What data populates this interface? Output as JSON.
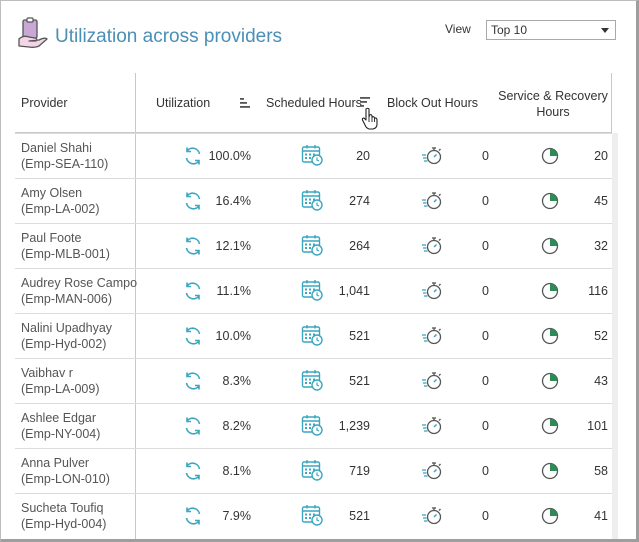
{
  "header": {
    "title": "Utilization across providers",
    "view_label": "View",
    "view_selected": "Top 10"
  },
  "columns": {
    "provider": "Provider",
    "utilization": "Utilization",
    "scheduled": "Scheduled Hours",
    "blockout": "Block Out Hours",
    "service_line1": "Service & Recovery",
    "service_line2": "Hours"
  },
  "icons": {
    "logo": "provider-clipboard-icon",
    "utilization": "refresh-icon",
    "scheduled": "calendar-clock-icon",
    "blockout": "stopwatch-icon",
    "service": "pie-chart-icon",
    "sort": "sort-icon",
    "cursor": "hand-cursor-icon"
  },
  "colors": {
    "title": "#4a8fb5",
    "icon_teal": "#3aa6bf",
    "pie_green": "#2e8b57"
  },
  "rows": [
    {
      "name": "Daniel Shahi",
      "id": "(Emp-SEA-110)",
      "utilization": "100.0%",
      "scheduled": "20",
      "blockout": "0",
      "service": "20",
      "service_fraction": 0.25
    },
    {
      "name": "Amy Olsen",
      "id": "(Emp-LA-002)",
      "utilization": "16.4%",
      "scheduled": "274",
      "blockout": "0",
      "service": "45",
      "service_fraction": 0.25
    },
    {
      "name": "Paul Foote",
      "id": "(Emp-MLB-001)",
      "utilization": "12.1%",
      "scheduled": "264",
      "blockout": "0",
      "service": "32",
      "service_fraction": 0.25
    },
    {
      "name": "Audrey Rose Campo",
      "id": "(Emp-MAN-006)",
      "utilization": "11.1%",
      "scheduled": "1,041",
      "blockout": "0",
      "service": "116",
      "service_fraction": 0.25
    },
    {
      "name": "Nalini Upadhyay",
      "id": "(Emp-Hyd-002)",
      "utilization": "10.0%",
      "scheduled": "521",
      "blockout": "0",
      "service": "52",
      "service_fraction": 0.25
    },
    {
      "name": "Vaibhav r",
      "id": "(Emp-LA-009)",
      "utilization": "8.3%",
      "scheduled": "521",
      "blockout": "0",
      "service": "43",
      "service_fraction": 0.25
    },
    {
      "name": "Ashlee Edgar",
      "id": "(Emp-NY-004)",
      "utilization": "8.2%",
      "scheduled": "1,239",
      "blockout": "0",
      "service": "101",
      "service_fraction": 0.25
    },
    {
      "name": "Anna Pulver",
      "id": "(Emp-LON-010)",
      "utilization": "8.1%",
      "scheduled": "719",
      "blockout": "0",
      "service": "58",
      "service_fraction": 0.25
    },
    {
      "name": "Sucheta Toufiq",
      "id": "(Emp-Hyd-004)",
      "utilization": "7.9%",
      "scheduled": "521",
      "blockout": "0",
      "service": "41",
      "service_fraction": 0.25
    }
  ]
}
